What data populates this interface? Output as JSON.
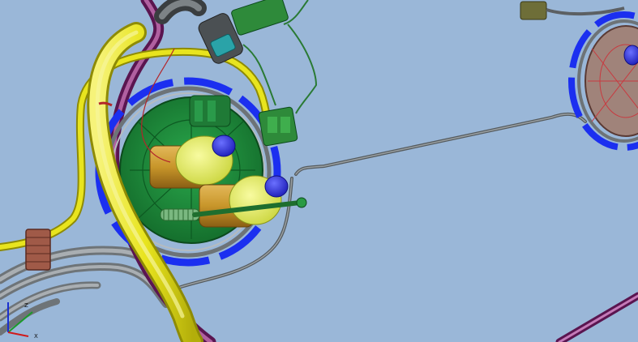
{
  "view": {
    "background_color": "#9ab7d8",
    "axis_labels": {
      "z": "Z",
      "x": "X"
    }
  },
  "colors": {
    "yellow_tube": "#e8e41e",
    "green_flange": "#1f8a3c",
    "blue_ring": "#1b2ff0",
    "pump_body": "#c8962a",
    "pump_cap": "#e6ef55",
    "pump_port": "#2f2fe0",
    "gray_line": "#7f8589",
    "purple_hose": "#8a2a7a",
    "connector_green": "#3a9a44",
    "bracket": "#a05a48"
  },
  "icons": {
    "axis": "axis-triad-icon"
  }
}
